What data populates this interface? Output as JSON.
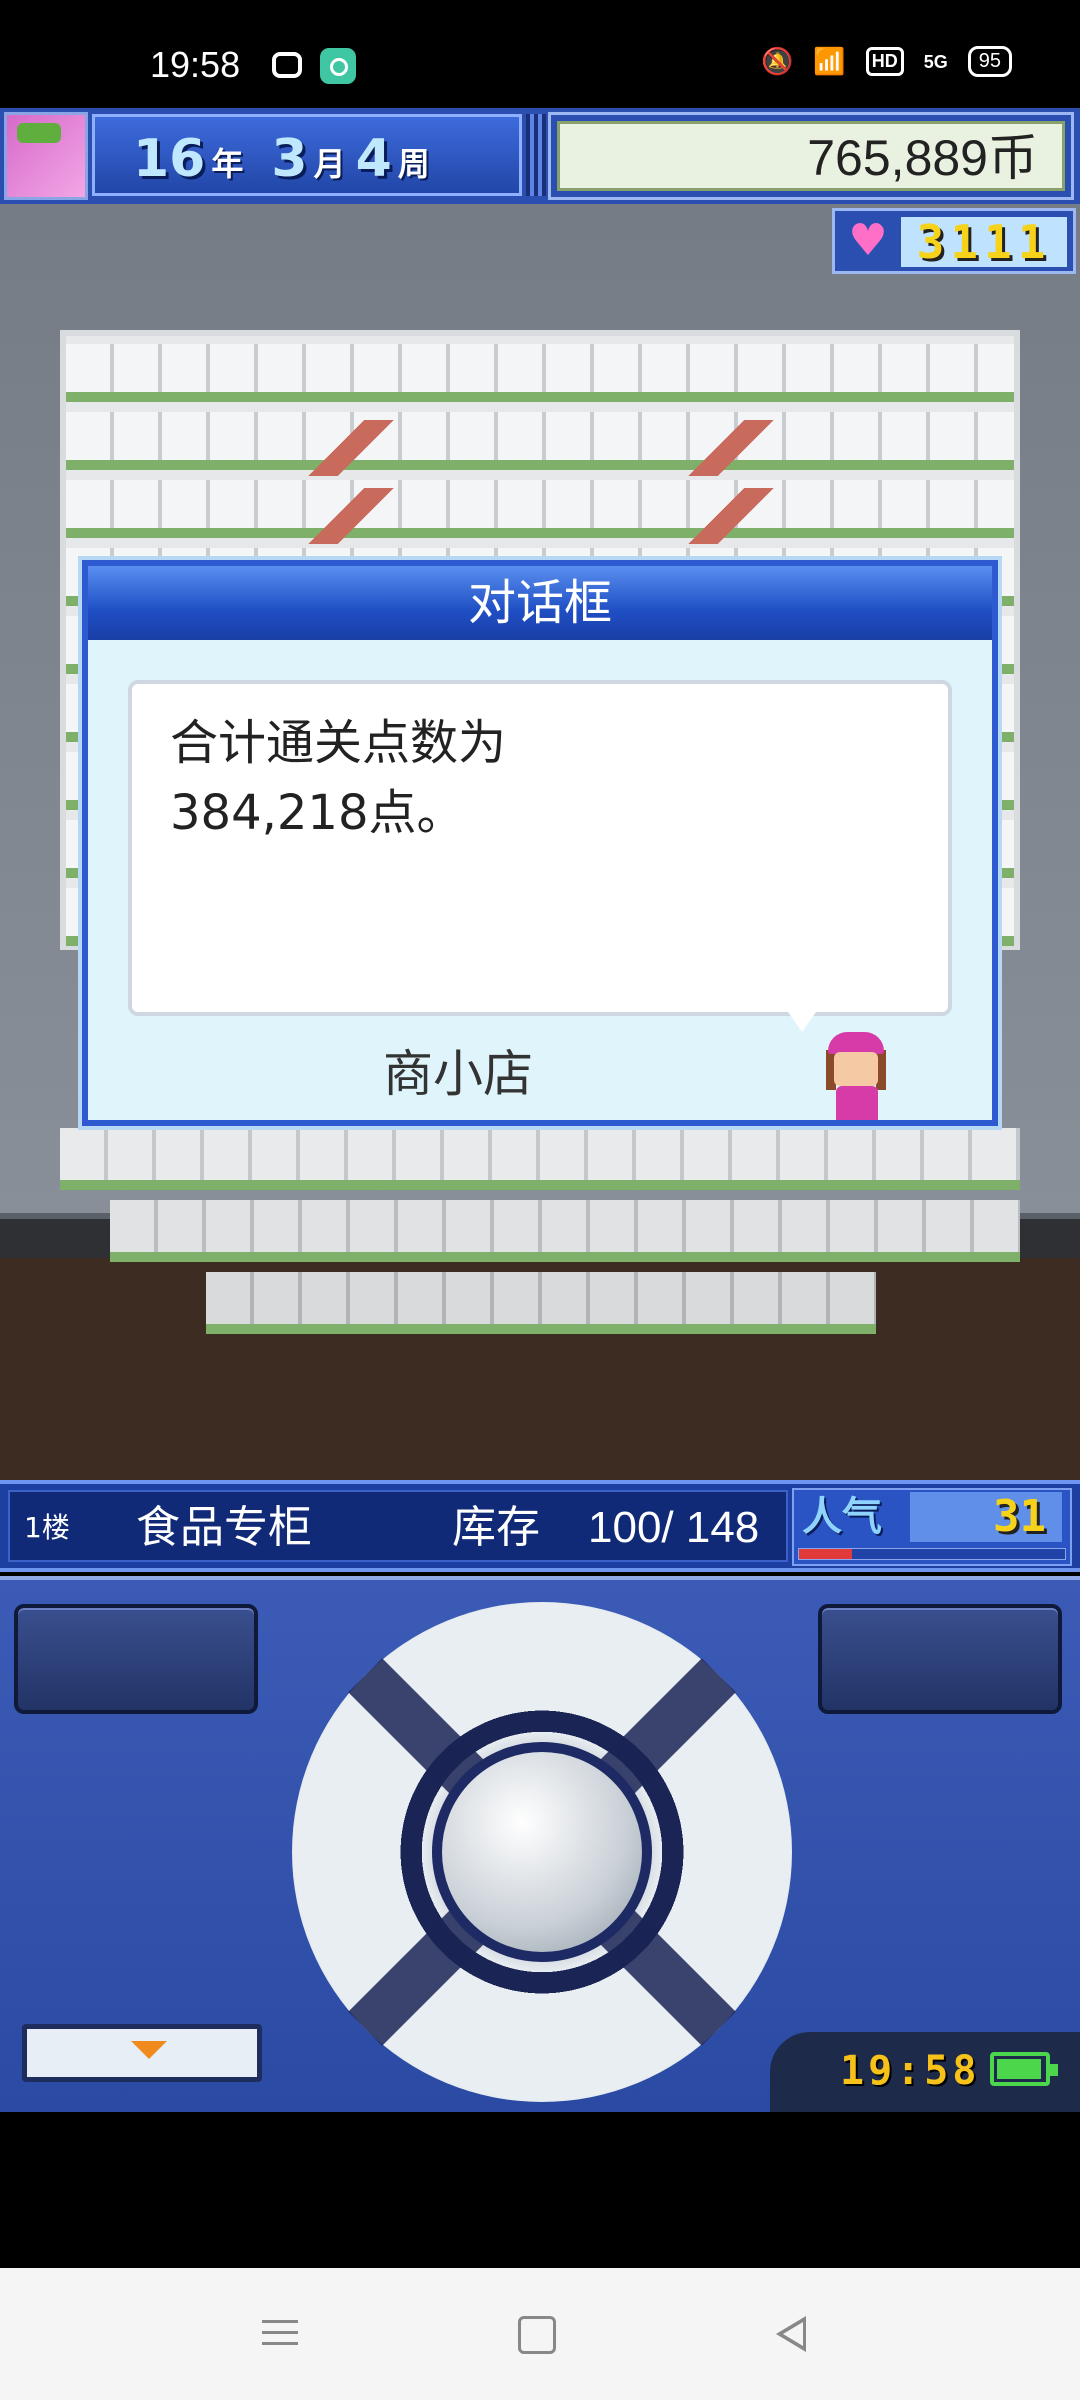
{
  "status_bar": {
    "time": "19:58",
    "battery": "95",
    "icons": [
      "notification-app-icon",
      "mute-icon",
      "wifi-icon",
      "hd-icon",
      "5g-signal-icon",
      "battery-icon"
    ],
    "hd_label": "HD",
    "network_label": "5G"
  },
  "game_header": {
    "year": "16",
    "year_unit": "年",
    "month": "3",
    "month_unit": "月",
    "week": "4",
    "week_unit": "周",
    "money": "765,889币",
    "popularity_hearts": "3111"
  },
  "dialog": {
    "title": "对话框",
    "message": "合计通关点数为\n384,218点。",
    "speaker": "商小店"
  },
  "info_bar": {
    "floor": "1楼",
    "shop_name": "食品专柜",
    "stock_label": "库存",
    "stock_value": "100/ 148",
    "popularity_label": "人气",
    "popularity_value": "31",
    "popularity_fraction": 0.2
  },
  "controller": {
    "clock": "19:58"
  },
  "colors": {
    "ui_blue": "#2b4fb0",
    "dialog_title_blue": "#1f4fc4",
    "popularity_red": "#e23a3a",
    "clock_yellow": "#f6c21a",
    "battery_green": "#4bd64b"
  }
}
